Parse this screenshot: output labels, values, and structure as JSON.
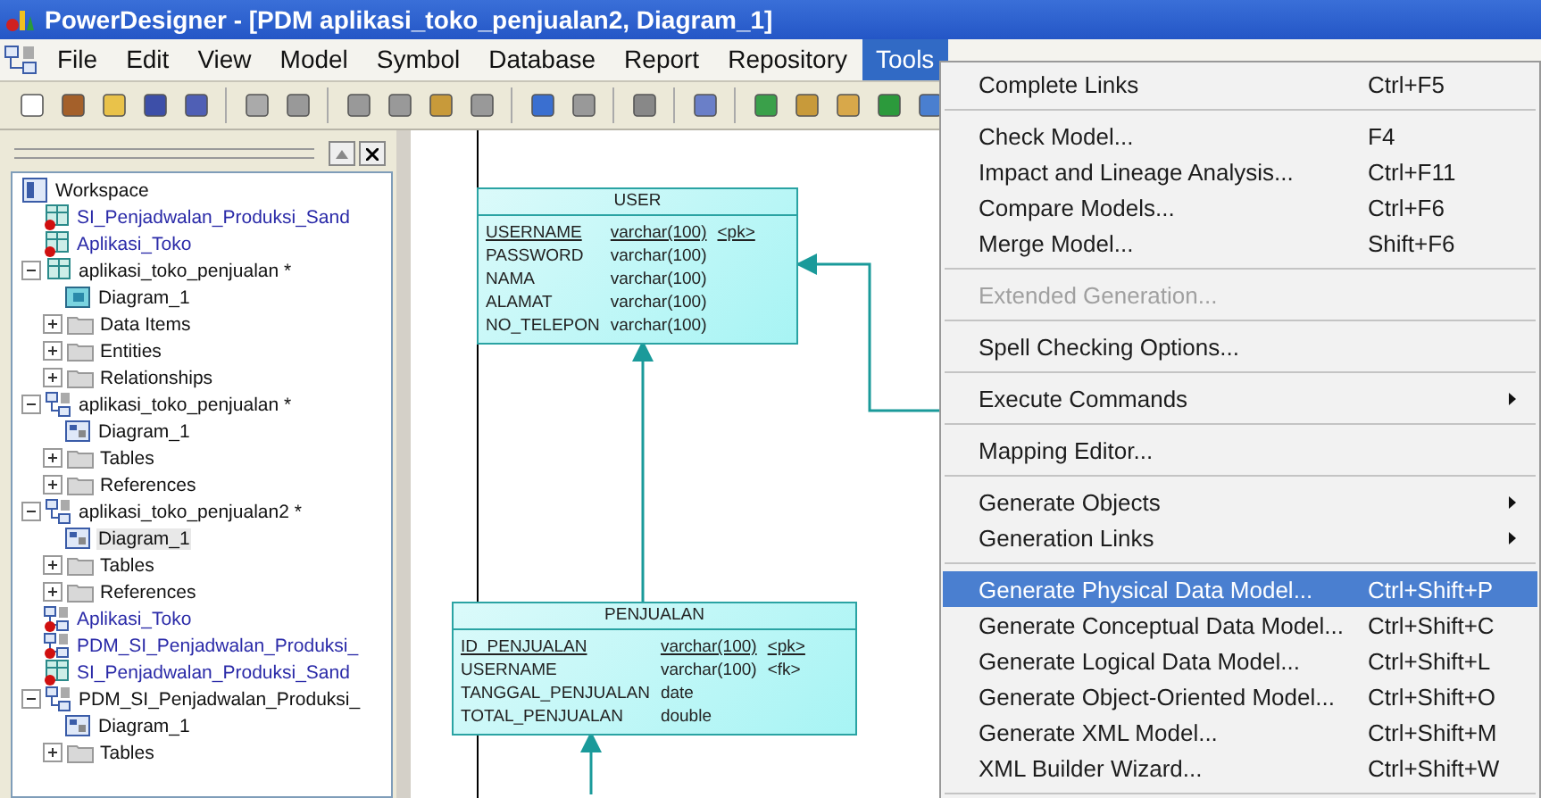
{
  "window": {
    "title": "PowerDesigner - [PDM aplikasi_toko_penjualan2, Diagram_1]"
  },
  "menu_bar": [
    {
      "label": "File",
      "selected": false
    },
    {
      "label": "Edit",
      "selected": false
    },
    {
      "label": "View",
      "selected": false
    },
    {
      "label": "Model",
      "selected": false
    },
    {
      "label": "Symbol",
      "selected": false
    },
    {
      "label": "Database",
      "selected": false
    },
    {
      "label": "Report",
      "selected": false
    },
    {
      "label": "Repository",
      "selected": false
    },
    {
      "label": "Tools",
      "selected": true
    }
  ],
  "browser": {
    "tree": [
      {
        "label": "Workspace",
        "kind": "workspace",
        "selected": false,
        "children": [
          {
            "label": "SI_Penjadwalan_Produksi_Sand",
            "kind": "cdm",
            "closed": true,
            "selected": false
          },
          {
            "label": "Aplikasi_Toko",
            "kind": "cdm",
            "closed": true,
            "selected": false
          },
          {
            "label": "aplikasi_toko_penjualan *",
            "kind": "cdm",
            "closed": false,
            "expanded": true,
            "selected": false,
            "children": [
              {
                "label": "Diagram_1",
                "kind": "cdm-diagram",
                "selected": false
              },
              {
                "label": "Data Items",
                "kind": "folder",
                "expanded": false,
                "selected": false
              },
              {
                "label": "Entities",
                "kind": "folder",
                "expanded": false,
                "selected": false
              },
              {
                "label": "Relationships",
                "kind": "folder",
                "expanded": false,
                "selected": false
              }
            ]
          },
          {
            "label": "aplikasi_toko_penjualan *",
            "kind": "pdm",
            "closed": false,
            "expanded": true,
            "selected": false,
            "children": [
              {
                "label": "Diagram_1",
                "kind": "pdm-diagram",
                "selected": false
              },
              {
                "label": "Tables",
                "kind": "folder",
                "expanded": false,
                "selected": false
              },
              {
                "label": "References",
                "kind": "folder",
                "expanded": false,
                "selected": false
              }
            ]
          },
          {
            "label": "aplikasi_toko_penjualan2 *",
            "kind": "pdm",
            "closed": false,
            "expanded": true,
            "selected": false,
            "children": [
              {
                "label": "Diagram_1",
                "kind": "pdm-diagram",
                "selected": true
              },
              {
                "label": "Tables",
                "kind": "folder",
                "expanded": false,
                "selected": false
              },
              {
                "label": "References",
                "kind": "folder",
                "expanded": false,
                "selected": false
              }
            ]
          },
          {
            "label": "Aplikasi_Toko",
            "kind": "pdm",
            "closed": true,
            "selected": false
          },
          {
            "label": "PDM_SI_Penjadwalan_Produksi_",
            "kind": "pdm",
            "closed": true,
            "selected": false
          },
          {
            "label": "SI_Penjadwalan_Produksi_Sand",
            "kind": "cdm",
            "closed": true,
            "selected": false
          },
          {
            "label": "PDM_SI_Penjadwalan_Produksi_",
            "kind": "pdm",
            "closed": false,
            "expanded": true,
            "selected": false,
            "children": [
              {
                "label": "Diagram_1",
                "kind": "pdm-diagram",
                "selected": false
              },
              {
                "label": "Tables",
                "kind": "folder",
                "expanded": false,
                "selected": false
              }
            ]
          }
        ]
      }
    ]
  },
  "diagram": {
    "tables": [
      {
        "name": "USER",
        "columns": [
          {
            "name": "USERNAME",
            "type": "varchar(100)",
            "key": "<pk>",
            "primary": true
          },
          {
            "name": "PASSWORD",
            "type": "varchar(100)",
            "primary": false
          },
          {
            "name": "NAMA",
            "type": "varchar(100)",
            "primary": false
          },
          {
            "name": "ALAMAT",
            "type": "varchar(100)",
            "primary": false
          },
          {
            "name": "NO_TELEPON",
            "type": "varchar(100)",
            "primary": false
          }
        ]
      },
      {
        "name": "PENJUALAN",
        "columns": [
          {
            "name": "ID_PENJUALAN",
            "type": "varchar(100)",
            "key": "<pk>",
            "primary": true
          },
          {
            "name": "USERNAME",
            "type": "varchar(100)",
            "key": "<fk>",
            "primary": false
          },
          {
            "name": "TANGGAL_PENJUALAN",
            "type": "date",
            "primary": false
          },
          {
            "name": "TOTAL_PENJUALAN",
            "type": "double",
            "primary": false
          }
        ]
      }
    ]
  },
  "tools_menu": [
    {
      "kind": "item",
      "label": "Complete Links",
      "shortcut": "Ctrl+F5",
      "disabled": false,
      "selected": false
    },
    {
      "kind": "separator"
    },
    {
      "kind": "item",
      "label": "Check Model...",
      "shortcut": "F4",
      "disabled": false,
      "selected": false
    },
    {
      "kind": "item",
      "label": "Impact and Lineage Analysis...",
      "shortcut": "Ctrl+F11",
      "disabled": false,
      "selected": false
    },
    {
      "kind": "item",
      "label": "Compare Models...",
      "shortcut": "Ctrl+F6",
      "disabled": false,
      "selected": false
    },
    {
      "kind": "item",
      "label": "Merge Model...",
      "shortcut": "Shift+F6",
      "disabled": false,
      "selected": false
    },
    {
      "kind": "separator"
    },
    {
      "kind": "item",
      "label": "Extended Generation...",
      "disabled": true,
      "selected": false
    },
    {
      "kind": "separator"
    },
    {
      "kind": "item",
      "label": "Spell Checking Options...",
      "disabled": false,
      "selected": false
    },
    {
      "kind": "separator"
    },
    {
      "kind": "item",
      "label": "Execute Commands",
      "submenu": true,
      "disabled": false,
      "selected": false
    },
    {
      "kind": "separator"
    },
    {
      "kind": "item",
      "label": "Mapping Editor...",
      "disabled": false,
      "selected": false
    },
    {
      "kind": "separator"
    },
    {
      "kind": "item",
      "label": "Generate Objects",
      "submenu": true,
      "disabled": false,
      "selected": false
    },
    {
      "kind": "item",
      "label": "Generation Links",
      "submenu": true,
      "disabled": false,
      "selected": false
    },
    {
      "kind": "separator"
    },
    {
      "kind": "item",
      "label": "Generate Physical Data Model...",
      "shortcut": "Ctrl+Shift+P",
      "disabled": false,
      "selected": true
    },
    {
      "kind": "item",
      "label": "Generate Conceptual Data Model...",
      "shortcut": "Ctrl+Shift+C",
      "disabled": false,
      "selected": false
    },
    {
      "kind": "item",
      "label": "Generate Logical Data Model...",
      "shortcut": "Ctrl+Shift+L",
      "disabled": false,
      "selected": false
    },
    {
      "kind": "item",
      "label": "Generate Object-Oriented Model...",
      "shortcut": "Ctrl+Shift+O",
      "disabled": false,
      "selected": false
    },
    {
      "kind": "item",
      "label": "Generate XML Model...",
      "shortcut": "Ctrl+Shift+M",
      "disabled": false,
      "selected": false
    },
    {
      "kind": "item",
      "label": "XML Builder Wizard...",
      "shortcut": "Ctrl+Shift+W",
      "disabled": false,
      "selected": false
    },
    {
      "kind": "separator"
    }
  ]
}
